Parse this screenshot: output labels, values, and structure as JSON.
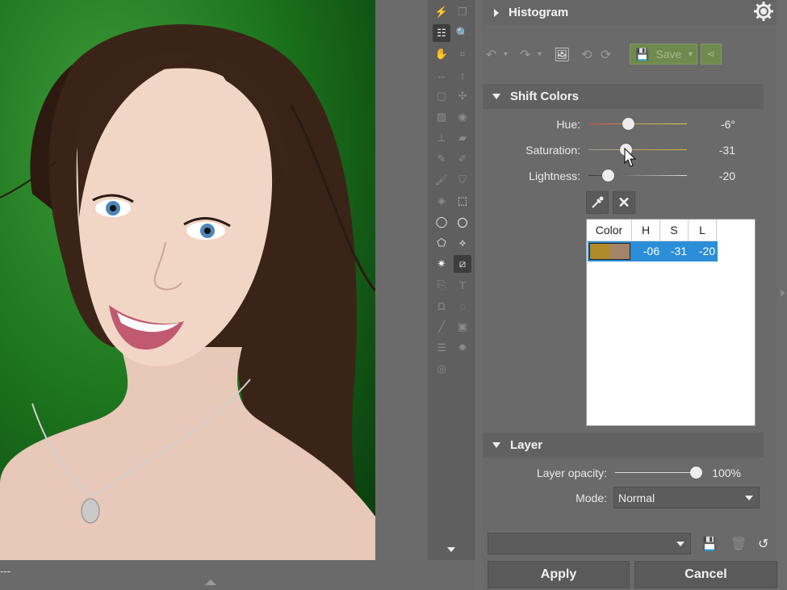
{
  "canvas": {
    "status_text": "---"
  },
  "toolbar": {
    "tools": [
      {
        "name": "lightning-icon",
        "glyph": "⚡",
        "enabled": false
      },
      {
        "name": "layers-icon",
        "glyph": "❐",
        "enabled": false
      },
      {
        "name": "adjust-panel-icon",
        "glyph": "☷",
        "enabled": true,
        "selected": true
      },
      {
        "name": "zoom-icon",
        "glyph": "🔍",
        "enabled": true
      },
      {
        "name": "hand-icon",
        "glyph": "✋",
        "enabled": true
      },
      {
        "name": "crop-icon",
        "glyph": "⌗",
        "enabled": false
      },
      {
        "name": "horizontal-resize-icon",
        "glyph": "↔",
        "enabled": false
      },
      {
        "name": "vertical-resize-icon",
        "glyph": "↕",
        "enabled": false
      },
      {
        "name": "transform-icon",
        "glyph": "▢",
        "enabled": false
      },
      {
        "name": "distort-icon",
        "glyph": "✣",
        "enabled": false
      },
      {
        "name": "gradient-icon",
        "glyph": "▨",
        "enabled": false
      },
      {
        "name": "red-eye-icon",
        "glyph": "◉",
        "enabled": false
      },
      {
        "name": "stamp-icon",
        "glyph": "⊥",
        "enabled": false
      },
      {
        "name": "eraser-icon",
        "glyph": "▰",
        "enabled": false
      },
      {
        "name": "healing-brush-icon",
        "glyph": "✎",
        "enabled": false
      },
      {
        "name": "magic-brush-icon",
        "glyph": "✐",
        "enabled": false
      },
      {
        "name": "brush-icon",
        "glyph": "🖌",
        "enabled": false
      },
      {
        "name": "bucket-icon",
        "glyph": "⛉",
        "enabled": false
      },
      {
        "name": "eraser-tool-icon",
        "glyph": "◈",
        "enabled": false
      },
      {
        "name": "rect-select-icon",
        "glyph": "⬚",
        "enabled": true
      },
      {
        "name": "ellipse-select-icon",
        "glyph": "◯",
        "enabled": true
      },
      {
        "name": "lasso-icon",
        "glyph": "〇",
        "enabled": true
      },
      {
        "name": "polygon-lasso-icon",
        "glyph": "⬠",
        "enabled": true
      },
      {
        "name": "magnetic-lasso-icon",
        "glyph": "⟡",
        "enabled": true
      },
      {
        "name": "magic-wand-icon",
        "glyph": "✷",
        "enabled": true
      },
      {
        "name": "selection-brush-icon",
        "glyph": "⧄",
        "enabled": true,
        "selected": true
      },
      {
        "name": "paste-icon",
        "glyph": "⎘",
        "enabled": false
      },
      {
        "name": "text-icon",
        "glyph": "T",
        "enabled": false
      },
      {
        "name": "symbol-icon",
        "glyph": "Ω",
        "enabled": false
      },
      {
        "name": "shape-icon",
        "glyph": "◌",
        "enabled": false
      },
      {
        "name": "line-icon",
        "glyph": "╱",
        "enabled": false
      },
      {
        "name": "watermark-icon",
        "glyph": "▣",
        "enabled": false
      },
      {
        "name": "straighten-icon",
        "glyph": "☰",
        "enabled": false
      },
      {
        "name": "settings-tool-icon",
        "glyph": "✹",
        "enabled": false
      },
      {
        "name": "vignette-icon",
        "glyph": "◎",
        "enabled": false
      }
    ],
    "more_icon": "chevron-down-icon"
  },
  "histogram": {
    "title": "Histogram",
    "settings_icon": "gear-icon"
  },
  "actions": {
    "save_label": "Save"
  },
  "shift_colors": {
    "title": "Shift Colors",
    "hue": {
      "label": "Hue:",
      "value": "-6°",
      "level": -6,
      "range": [
        -180,
        180
      ]
    },
    "saturation": {
      "label": "Saturation:",
      "value": "-31",
      "level": -31,
      "range": [
        -100,
        100
      ]
    },
    "lightness": {
      "label": "Lightness:",
      "value": "-20",
      "level": -20,
      "range": [
        -100,
        100
      ]
    },
    "table": {
      "headers": [
        "Color",
        "H",
        "S",
        "L"
      ],
      "rows": [
        {
          "h": "-06",
          "s": "-31",
          "l": "-20",
          "color_a": "#b08a2a",
          "color_b": "#a38466"
        }
      ]
    }
  },
  "layer": {
    "title": "Layer",
    "opacity": {
      "label": "Layer opacity:",
      "value": "100%",
      "level": 100
    },
    "mode": {
      "label": "Mode:",
      "value": "Normal"
    }
  },
  "footer": {
    "apply_label": "Apply",
    "cancel_label": "Cancel"
  },
  "colors": {
    "accent_selection": "#2d8ed8",
    "save_green": "#6f8a4e"
  }
}
